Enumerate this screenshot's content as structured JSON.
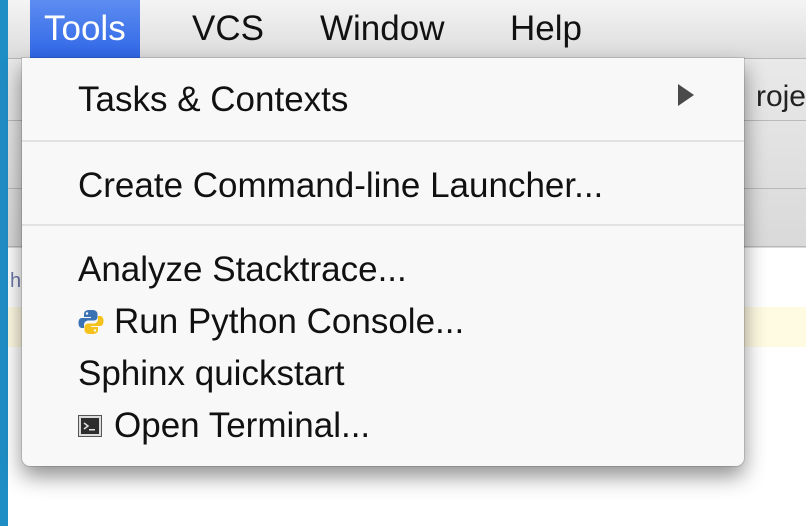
{
  "menubar": {
    "items": [
      {
        "label": "Tools"
      },
      {
        "label": "VCS"
      },
      {
        "label": "Window"
      },
      {
        "label": "Help"
      }
    ]
  },
  "background_fragments": {
    "breadcrumb": "roje",
    "left_text": "hat"
  },
  "menu": {
    "items": [
      {
        "label": "Tasks & Contexts"
      },
      {
        "label": "Create Command-line Launcher..."
      },
      {
        "label": "Analyze Stacktrace..."
      },
      {
        "label": "Run Python Console...",
        "icon": "python-icon"
      },
      {
        "label": "Sphinx quickstart"
      },
      {
        "label": "Open Terminal...",
        "icon": "terminal-icon"
      }
    ]
  }
}
